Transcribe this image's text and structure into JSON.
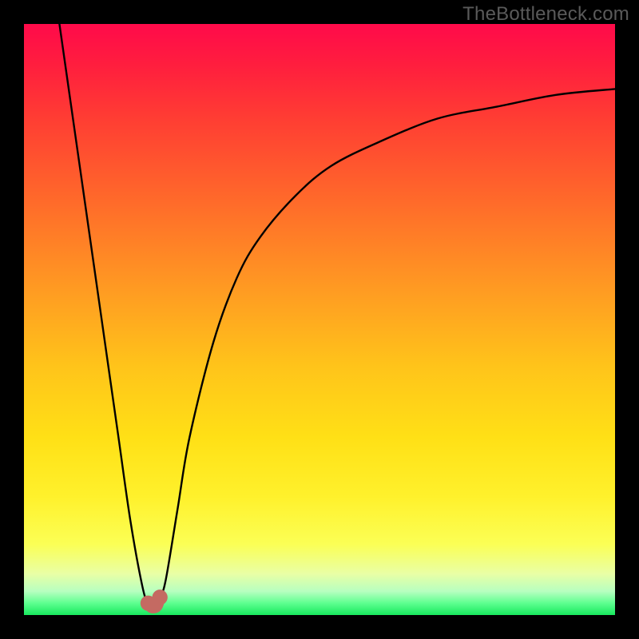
{
  "watermark": {
    "text": "TheBottleneck.com"
  },
  "chart_data": {
    "type": "line",
    "title": "",
    "xlabel": "",
    "ylabel": "",
    "xlim": [
      0,
      100
    ],
    "ylim": [
      0,
      100
    ],
    "grid": false,
    "legend": false,
    "background_gradient": {
      "direction": "vertical",
      "stops": [
        {
          "pos": 0.0,
          "color": "#ff0a4a"
        },
        {
          "pos": 0.3,
          "color": "#ff6a2a"
        },
        {
          "pos": 0.58,
          "color": "#ffc41a"
        },
        {
          "pos": 0.8,
          "color": "#fff12c"
        },
        {
          "pos": 0.93,
          "color": "#e9ffa5"
        },
        {
          "pos": 1.0,
          "color": "#18e85e"
        }
      ]
    },
    "series": [
      {
        "name": "bottleneck-curve",
        "color": "#000000",
        "x": [
          6,
          8,
          10,
          12,
          14,
          16,
          18,
          20,
          21,
          22,
          23,
          24,
          26,
          28,
          32,
          36,
          40,
          46,
          52,
          60,
          70,
          80,
          90,
          100
        ],
        "y": [
          100,
          86,
          72,
          58,
          44,
          30,
          16,
          5,
          2,
          2,
          3,
          6,
          18,
          30,
          46,
          57,
          64,
          71,
          76,
          80,
          84,
          86,
          88,
          89
        ]
      }
    ],
    "markers": [
      {
        "x": 21,
        "y": 2,
        "r": 1.3,
        "color": "#c46a62"
      },
      {
        "x": 23,
        "y": 3,
        "r": 1.3,
        "color": "#c46a62"
      }
    ],
    "trough_segment": {
      "path_x": [
        21,
        21.5,
        22,
        22.5,
        23
      ],
      "path_y": [
        2,
        1.4,
        1.3,
        1.6,
        3
      ],
      "color": "#c46a62",
      "width": 2.0
    }
  }
}
